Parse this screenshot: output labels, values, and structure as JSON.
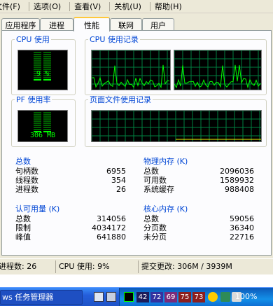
{
  "menu": [
    "文件(F)",
    "选项(O)",
    "查看(V)",
    "关机(U)",
    "帮助(H)"
  ],
  "tabs": [
    "应用程序",
    "进程",
    "性能",
    "联网",
    "用户"
  ],
  "active_tab": "性能",
  "cpu_usage": {
    "title": "CPU 使用",
    "label": "9 %",
    "value_percent": 9
  },
  "cpu_history": {
    "title": "CPU 使用记录"
  },
  "pf_usage": {
    "title": "PF 使用率",
    "label": "306 MB"
  },
  "pf_history": {
    "title": "页面文件使用记录"
  },
  "totals": {
    "title": "总数",
    "rows": [
      {
        "label": "句柄数",
        "value": "6955"
      },
      {
        "label": "线程数",
        "value": "354"
      },
      {
        "label": "进程数",
        "value": "26"
      }
    ]
  },
  "physical_memory": {
    "title": "物理内存 (K)",
    "rows": [
      {
        "label": "总数",
        "value": "2096036"
      },
      {
        "label": "可用数",
        "value": "1589932"
      },
      {
        "label": "系统缓存",
        "value": "988408"
      }
    ]
  },
  "commit_charge": {
    "title": "认可用量 (K)",
    "rows": [
      {
        "label": "总数",
        "value": "314056"
      },
      {
        "label": "限制",
        "value": "4034172"
      },
      {
        "label": "峰值",
        "value": "641880"
      }
    ]
  },
  "kernel_memory": {
    "title": "核心内存 (K)",
    "rows": [
      {
        "label": "总数",
        "value": "59056"
      },
      {
        "label": "分页数",
        "value": "36340"
      },
      {
        "label": "未分页",
        "value": "22716"
      }
    ]
  },
  "status": {
    "processes": "进程数: 26",
    "cpu": "CPU 使用: 9%",
    "commit": "提交更改: 306M / 3939M"
  },
  "taskbar": {
    "task_label": "ws 任务管理器",
    "tray_numbers": [
      "42",
      "72",
      "69",
      "75",
      "73"
    ],
    "clock": "100%"
  },
  "colors": {
    "graph_line": "#00ff00",
    "grid": "#008040",
    "pf_line": "#ffff00",
    "accent": "#0046d5"
  }
}
